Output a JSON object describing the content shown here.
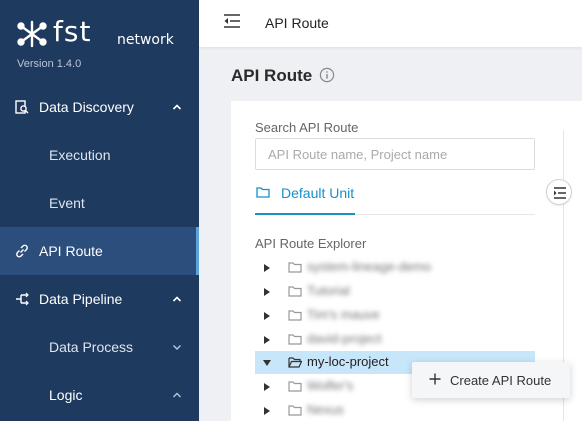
{
  "brand": {
    "name": "fst",
    "sub": "network",
    "version": "Version 1.4.0"
  },
  "sidebar": {
    "items": [
      {
        "label": "Data Discovery"
      },
      {
        "label": "Execution"
      },
      {
        "label": "Event"
      },
      {
        "label": "API Route"
      },
      {
        "label": "Data Pipeline"
      },
      {
        "label": "Data Process"
      },
      {
        "label": "Logic"
      }
    ]
  },
  "topbar": {
    "title": "API Route"
  },
  "page": {
    "title": "API Route"
  },
  "search": {
    "label": "Search API Route",
    "placeholder": "API Route name, Project name",
    "value": ""
  },
  "unit": {
    "label": "Default Unit"
  },
  "explorer": {
    "label": "API Route Explorer",
    "items": [
      {
        "name": "system-lineage-demo"
      },
      {
        "name": "Tutorial"
      },
      {
        "name": "Tim's mauve"
      },
      {
        "name": "david-project"
      },
      {
        "name": "my-loc-project"
      },
      {
        "name": "Wolfer's"
      },
      {
        "name": "Nexus"
      }
    ]
  },
  "context_menu": {
    "create_label": "Create API Route"
  },
  "colors": {
    "sidebar": "#1f3a5f",
    "sidebar_active": "#2b4e7c",
    "accent": "#1890c8",
    "selected_row": "#c8e6f9"
  }
}
